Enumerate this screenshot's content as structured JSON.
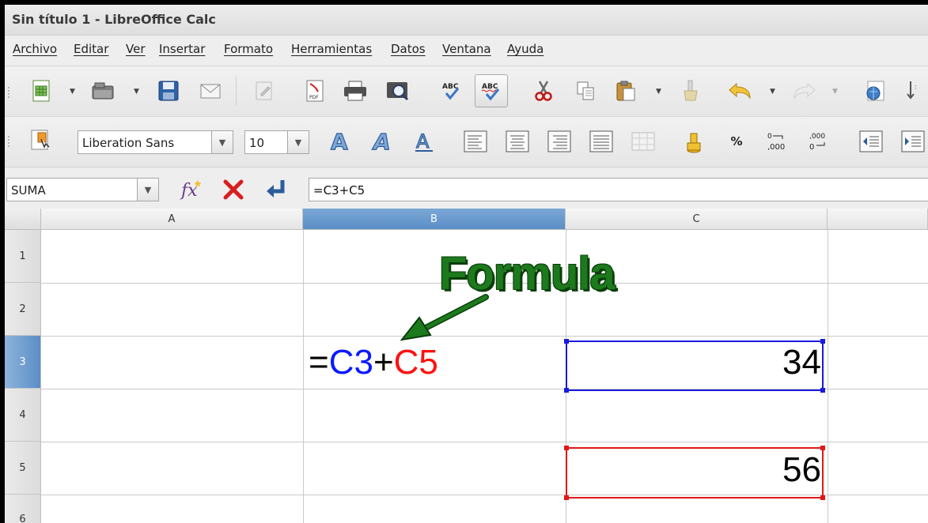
{
  "window": {
    "title": "Sin título 1 - LibreOffice Calc"
  },
  "menu": [
    "Archivo",
    "Editar",
    "Ver",
    "Insertar",
    "Formato",
    "Herramientas",
    "Datos",
    "Ventana",
    "Ayuda"
  ],
  "toolbar_standard": {
    "icons": [
      "new-spreadsheet-icon",
      "open-folder-icon",
      "save-icon",
      "email-icon",
      "edit-file-icon",
      "export-pdf-icon",
      "print-icon",
      "print-preview-icon",
      "spellcheck-icon",
      "autospellcheck-icon",
      "cut-icon",
      "copy-icon",
      "paste-icon",
      "clone-formatting-icon",
      "undo-icon",
      "redo-icon",
      "navigator-icon",
      "sort-icon"
    ]
  },
  "toolbar_format": {
    "font_name": "Liberation Sans",
    "font_size": "10",
    "number_format_percent": "%",
    "add_decimal": "0.000",
    "remove_decimal": ",000"
  },
  "formula_bar": {
    "name_box": "SUMA",
    "content": "=C3+C5"
  },
  "sheet": {
    "columns": [
      "A",
      "B",
      "C"
    ],
    "selected_column": "B",
    "rows": [
      "1",
      "2",
      "3",
      "4",
      "5",
      "6"
    ],
    "selected_row": "3",
    "formula_parts": [
      {
        "text": "=",
        "color": "#000000"
      },
      {
        "text": "C3",
        "color": "#0a1aff"
      },
      {
        "text": "+",
        "color": "#000000"
      },
      {
        "text": "C5",
        "color": "#ff1010"
      }
    ],
    "cell_C3": "34",
    "cell_C5": "56",
    "ref_colors": {
      "c3": "#1a1adc",
      "c5": "#e01818"
    }
  },
  "annotation": {
    "label": "Formula",
    "color": "#1c7a1c"
  }
}
